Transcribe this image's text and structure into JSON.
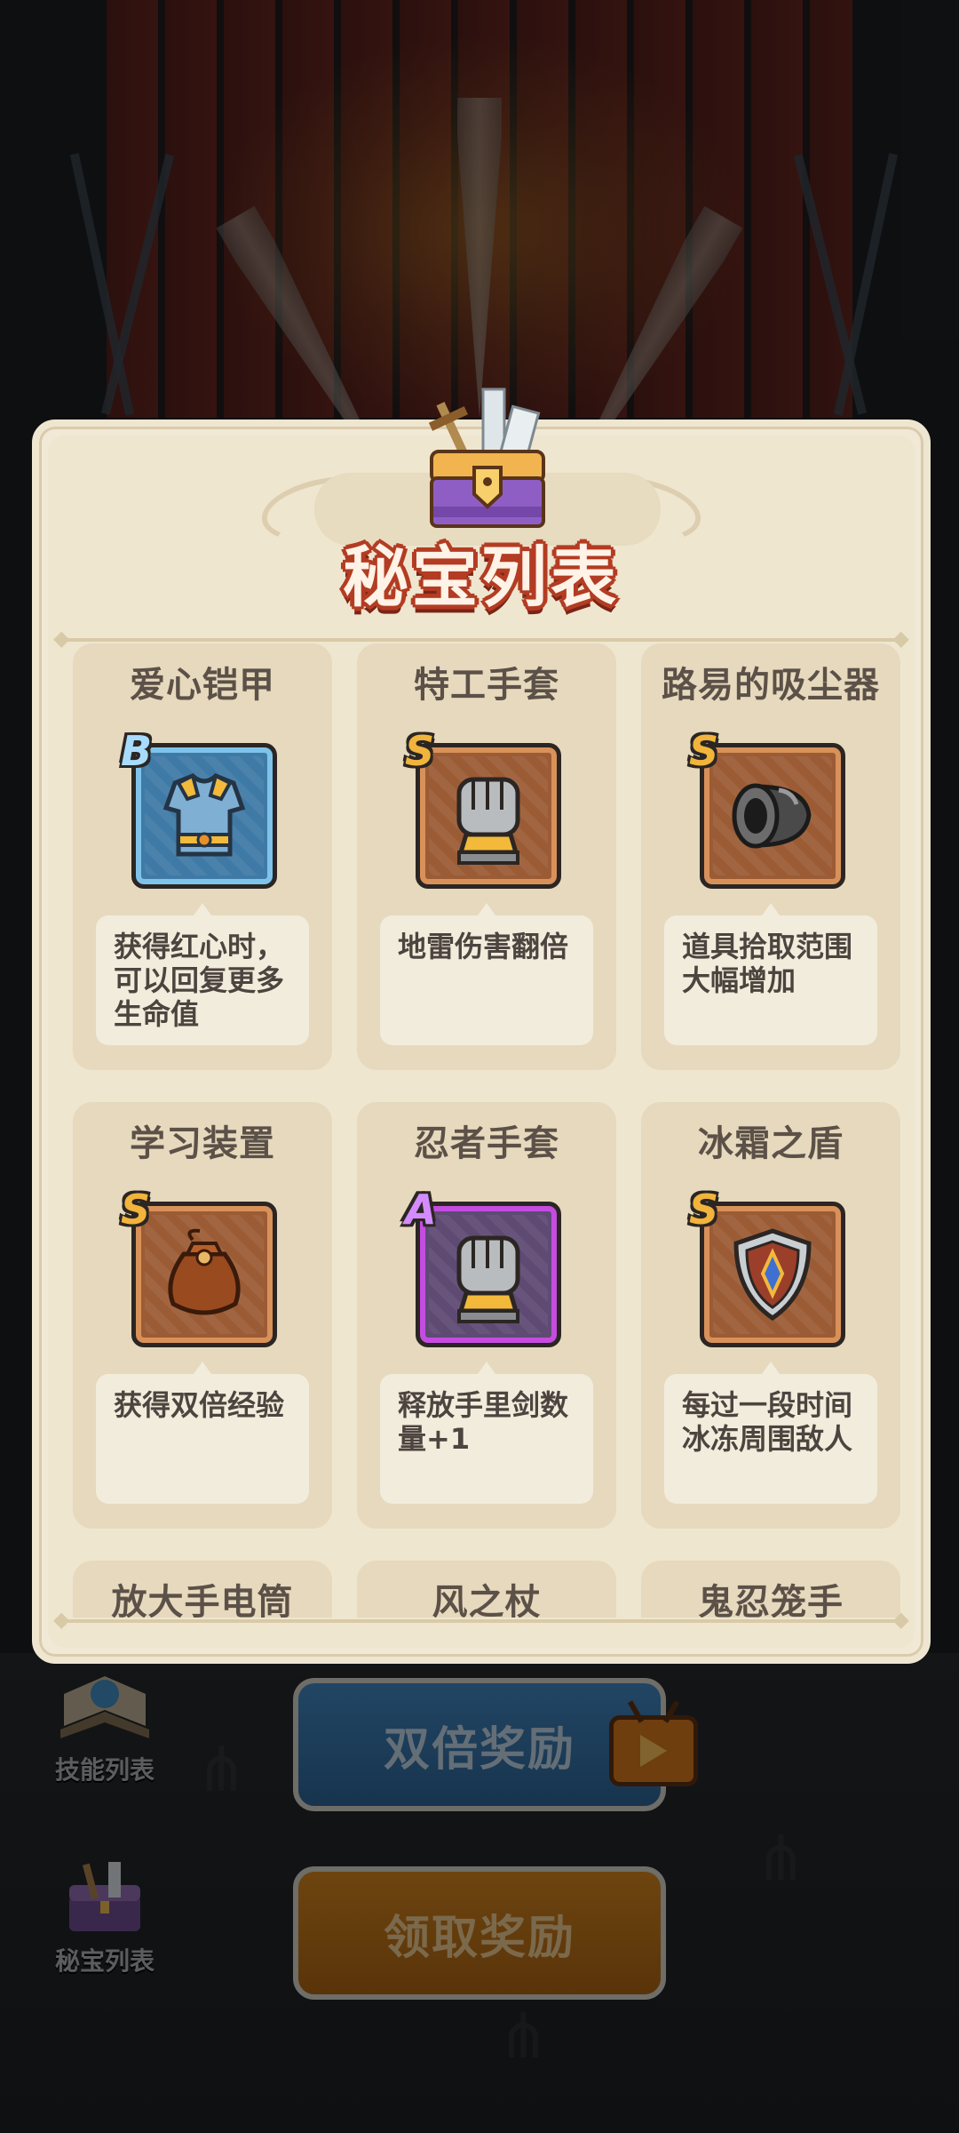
{
  "panel": {
    "title": "秘宝列表",
    "items": [
      {
        "name": "爱心铠甲",
        "rank": "B",
        "icon": "armor-icon",
        "desc": "获得红心时，可以回复更多生命值"
      },
      {
        "name": "特工手套",
        "rank": "S",
        "icon": "gauntlet-icon",
        "desc": "地雷伤害翻倍"
      },
      {
        "name": "路易的吸尘器",
        "rank": "S",
        "icon": "vacuum-nozzle-icon",
        "desc": "道具拾取范围大幅增加"
      },
      {
        "name": "学习装置",
        "rank": "S",
        "icon": "pouch-icon",
        "desc": "获得双倍经验"
      },
      {
        "name": "忍者手套",
        "rank": "A",
        "icon": "gauntlet-icon",
        "desc": "释放手里剑数量+1"
      },
      {
        "name": "冰霜之盾",
        "rank": "S",
        "icon": "shield-icon",
        "desc": "每过一段时间冰冻周围敌人"
      },
      {
        "name": "放大手电筒",
        "rank": "",
        "icon": "",
        "desc": ""
      },
      {
        "name": "风之杖",
        "rank": "",
        "icon": "",
        "desc": ""
      },
      {
        "name": "鬼忍笼手",
        "rank": "",
        "icon": "",
        "desc": ""
      }
    ]
  },
  "sidebar": {
    "skill_list_label": "技能列表",
    "treasure_list_label": "秘宝列表"
  },
  "buttons": {
    "double_reward": "双倍奖励",
    "claim_reward": "领取奖励"
  },
  "colors": {
    "rank_B": "#7fc3eb",
    "rank_S": "#d9915a",
    "rank_A": "#c54ce0",
    "title_outline": "#b33c23"
  }
}
